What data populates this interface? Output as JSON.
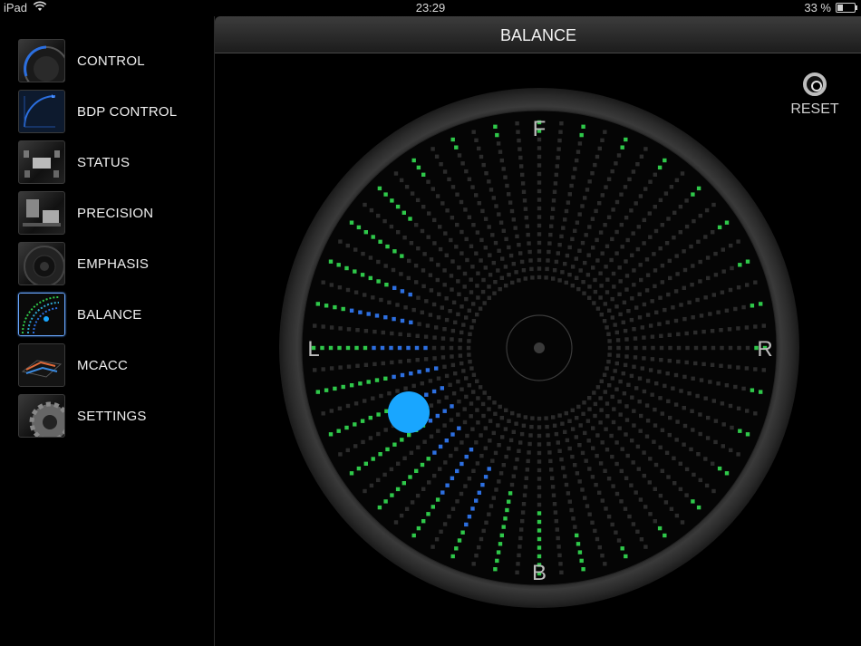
{
  "status_bar": {
    "device": "iPad",
    "time": "23:29",
    "battery": "33 %",
    "battery_level": 0.33
  },
  "sidebar": {
    "items": [
      {
        "label": "CONTROL",
        "icon": "control-icon"
      },
      {
        "label": "BDP CONTROL",
        "icon": "bdp-control-icon"
      },
      {
        "label": "STATUS",
        "icon": "status-icon"
      },
      {
        "label": "PRECISION",
        "icon": "precision-icon"
      },
      {
        "label": "EMPHASIS",
        "icon": "emphasis-icon"
      },
      {
        "label": "BALANCE",
        "icon": "balance-icon",
        "active": true
      },
      {
        "label": "MCACC",
        "icon": "mcacc-icon"
      },
      {
        "label": "SETTINGS",
        "icon": "settings-icon"
      }
    ]
  },
  "main": {
    "title": "BALANCE",
    "reset_label": "RESET",
    "balance": {
      "labels": {
        "front": "F",
        "back": "B",
        "left": "L",
        "right": "R"
      },
      "colors": {
        "dot_blue": "#19a6ff",
        "led_green": "#2fc84a",
        "led_blue": "#2d6fe0",
        "led_off": "#2b2b2b"
      }
    }
  }
}
